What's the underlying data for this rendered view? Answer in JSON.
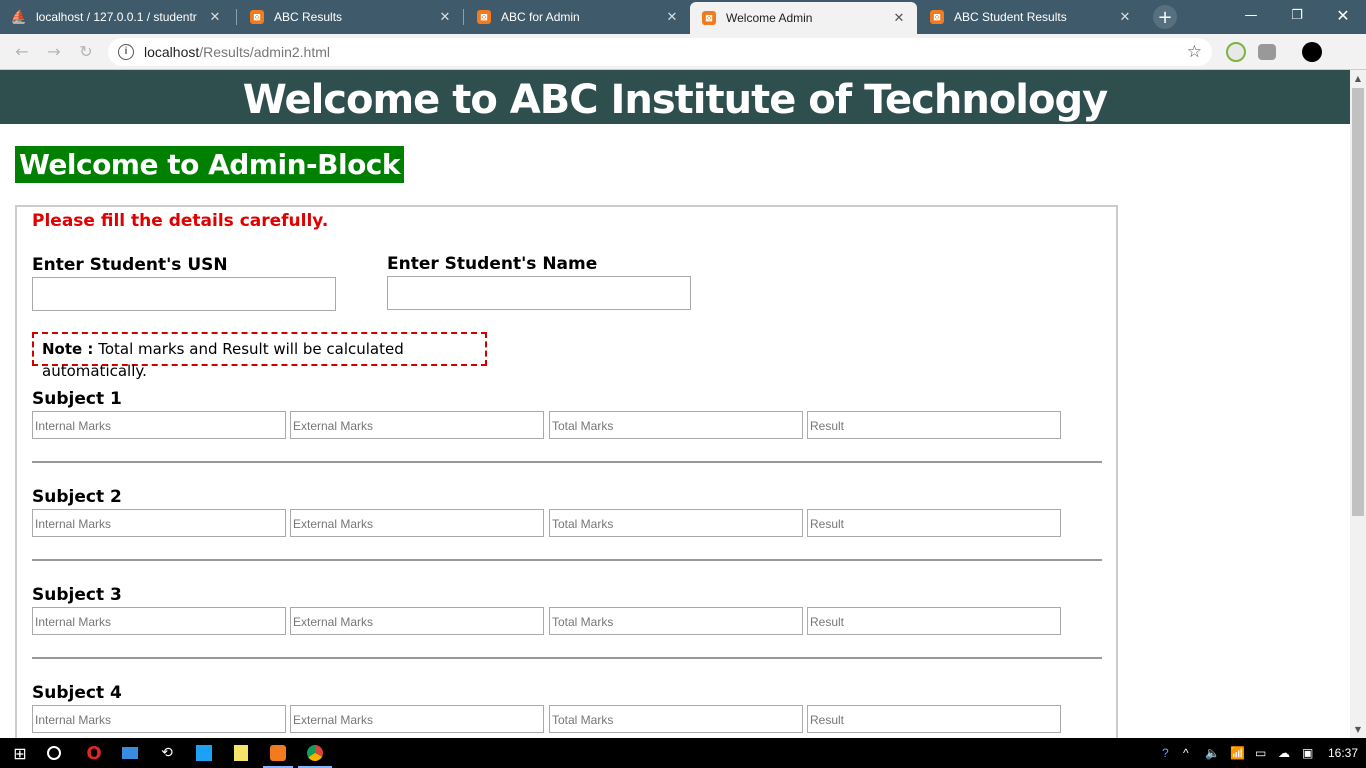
{
  "browser": {
    "tabs": [
      {
        "title": "localhost / 127.0.0.1 / studentr",
        "icon": "phpmyadmin-icon"
      },
      {
        "title": "ABC Results",
        "icon": "xampp-icon"
      },
      {
        "title": "ABC for Admin",
        "icon": "xampp-icon"
      },
      {
        "title": "Welcome Admin",
        "icon": "xampp-icon",
        "active": true
      },
      {
        "title": "ABC Student Results",
        "icon": "xampp-icon"
      }
    ],
    "url_host": "localhost",
    "url_path": "/Results/admin2.html"
  },
  "page": {
    "banner": "Welcome to ABC Institute of Technology",
    "admin_title": "Welcome to Admin-Block",
    "warning": "Please fill the details carefully.",
    "usn_label": "Enter Student's USN",
    "name_label": "Enter Student's Name",
    "note_label": "Note :",
    "note_text": " Total marks and Result will be calculated automatically.",
    "subjects": [
      {
        "label": "Subject 1"
      },
      {
        "label": "Subject 2"
      },
      {
        "label": "Subject 3"
      },
      {
        "label": "Subject 4"
      }
    ],
    "placeholders": {
      "internal": "Internal Marks",
      "external": "External Marks",
      "total": "Total Marks",
      "result": "Result"
    }
  },
  "taskbar": {
    "clock": "16:37"
  },
  "colors": {
    "banner_bg": "#2f4f4f",
    "admin_bg": "#008000",
    "warning": "#e00000",
    "tabstrip": "#3f5a6a"
  }
}
